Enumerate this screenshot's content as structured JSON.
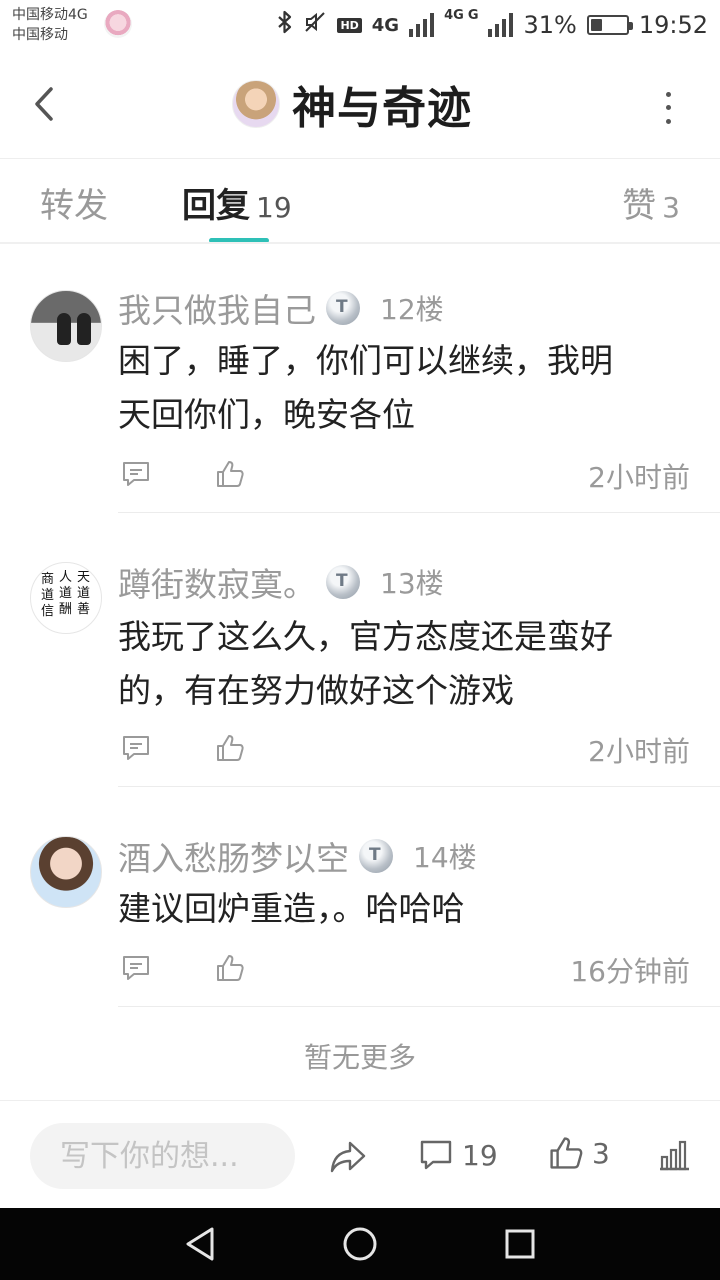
{
  "status_bar": {
    "carrier_1": "中国移动4G",
    "carrier_2": "中国移动",
    "network_1": "4G",
    "network_2": "4G",
    "network_3": "G",
    "battery_percent": "31%",
    "battery_level": 0.31,
    "time": "19:52",
    "icons": [
      "bluetooth-icon",
      "mute-icon",
      "hd-icon",
      "signal-icon",
      "battery-icon"
    ]
  },
  "header": {
    "title": "神与奇迹",
    "back_icon": "chevron-left-icon",
    "more_icon": "more-vertical-icon"
  },
  "tabs": {
    "forward": {
      "label": "转发"
    },
    "reply": {
      "label": "回复",
      "count": "19"
    },
    "like": {
      "label": "赞",
      "count": "3"
    },
    "accent_color": "#2ec0b7"
  },
  "replies": [
    {
      "name": "我只做我自己",
      "floor": "12楼",
      "content_line1": "困了，睡了，你们可以继续，我明",
      "content_line2": "天回你们，晚安各位",
      "time": "2小时前"
    },
    {
      "name": "蹲街数寂寞。",
      "floor": "13楼",
      "content_line1": "我玩了这么久，官方态度还是蛮好",
      "content_line2": "的，有在努力做好这个游戏",
      "time": "2小时前"
    },
    {
      "name": "酒入愁肠梦以空",
      "floor": "14楼",
      "content_line1": "建议回炉重造，。哈哈哈",
      "time": "16分钟前"
    }
  ],
  "footer_note": "暂无更多",
  "bottom_bar": {
    "input_placeholder": "写下你的想...",
    "comment_count": "19",
    "like_count": "3"
  }
}
